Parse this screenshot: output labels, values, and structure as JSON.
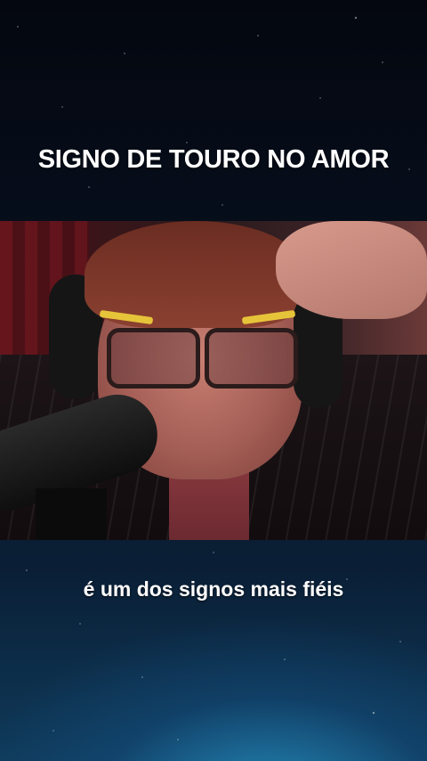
{
  "overlay": {
    "title": "SIGNO DE TOURO NO AMOR",
    "caption": "é um dos signos mais fiéis"
  },
  "video": {
    "icon": "video-frame-person-with-headphones"
  },
  "colors": {
    "background_top": "#04070f",
    "background_bottom": "#0f3a5a",
    "text": "#ffffff"
  }
}
